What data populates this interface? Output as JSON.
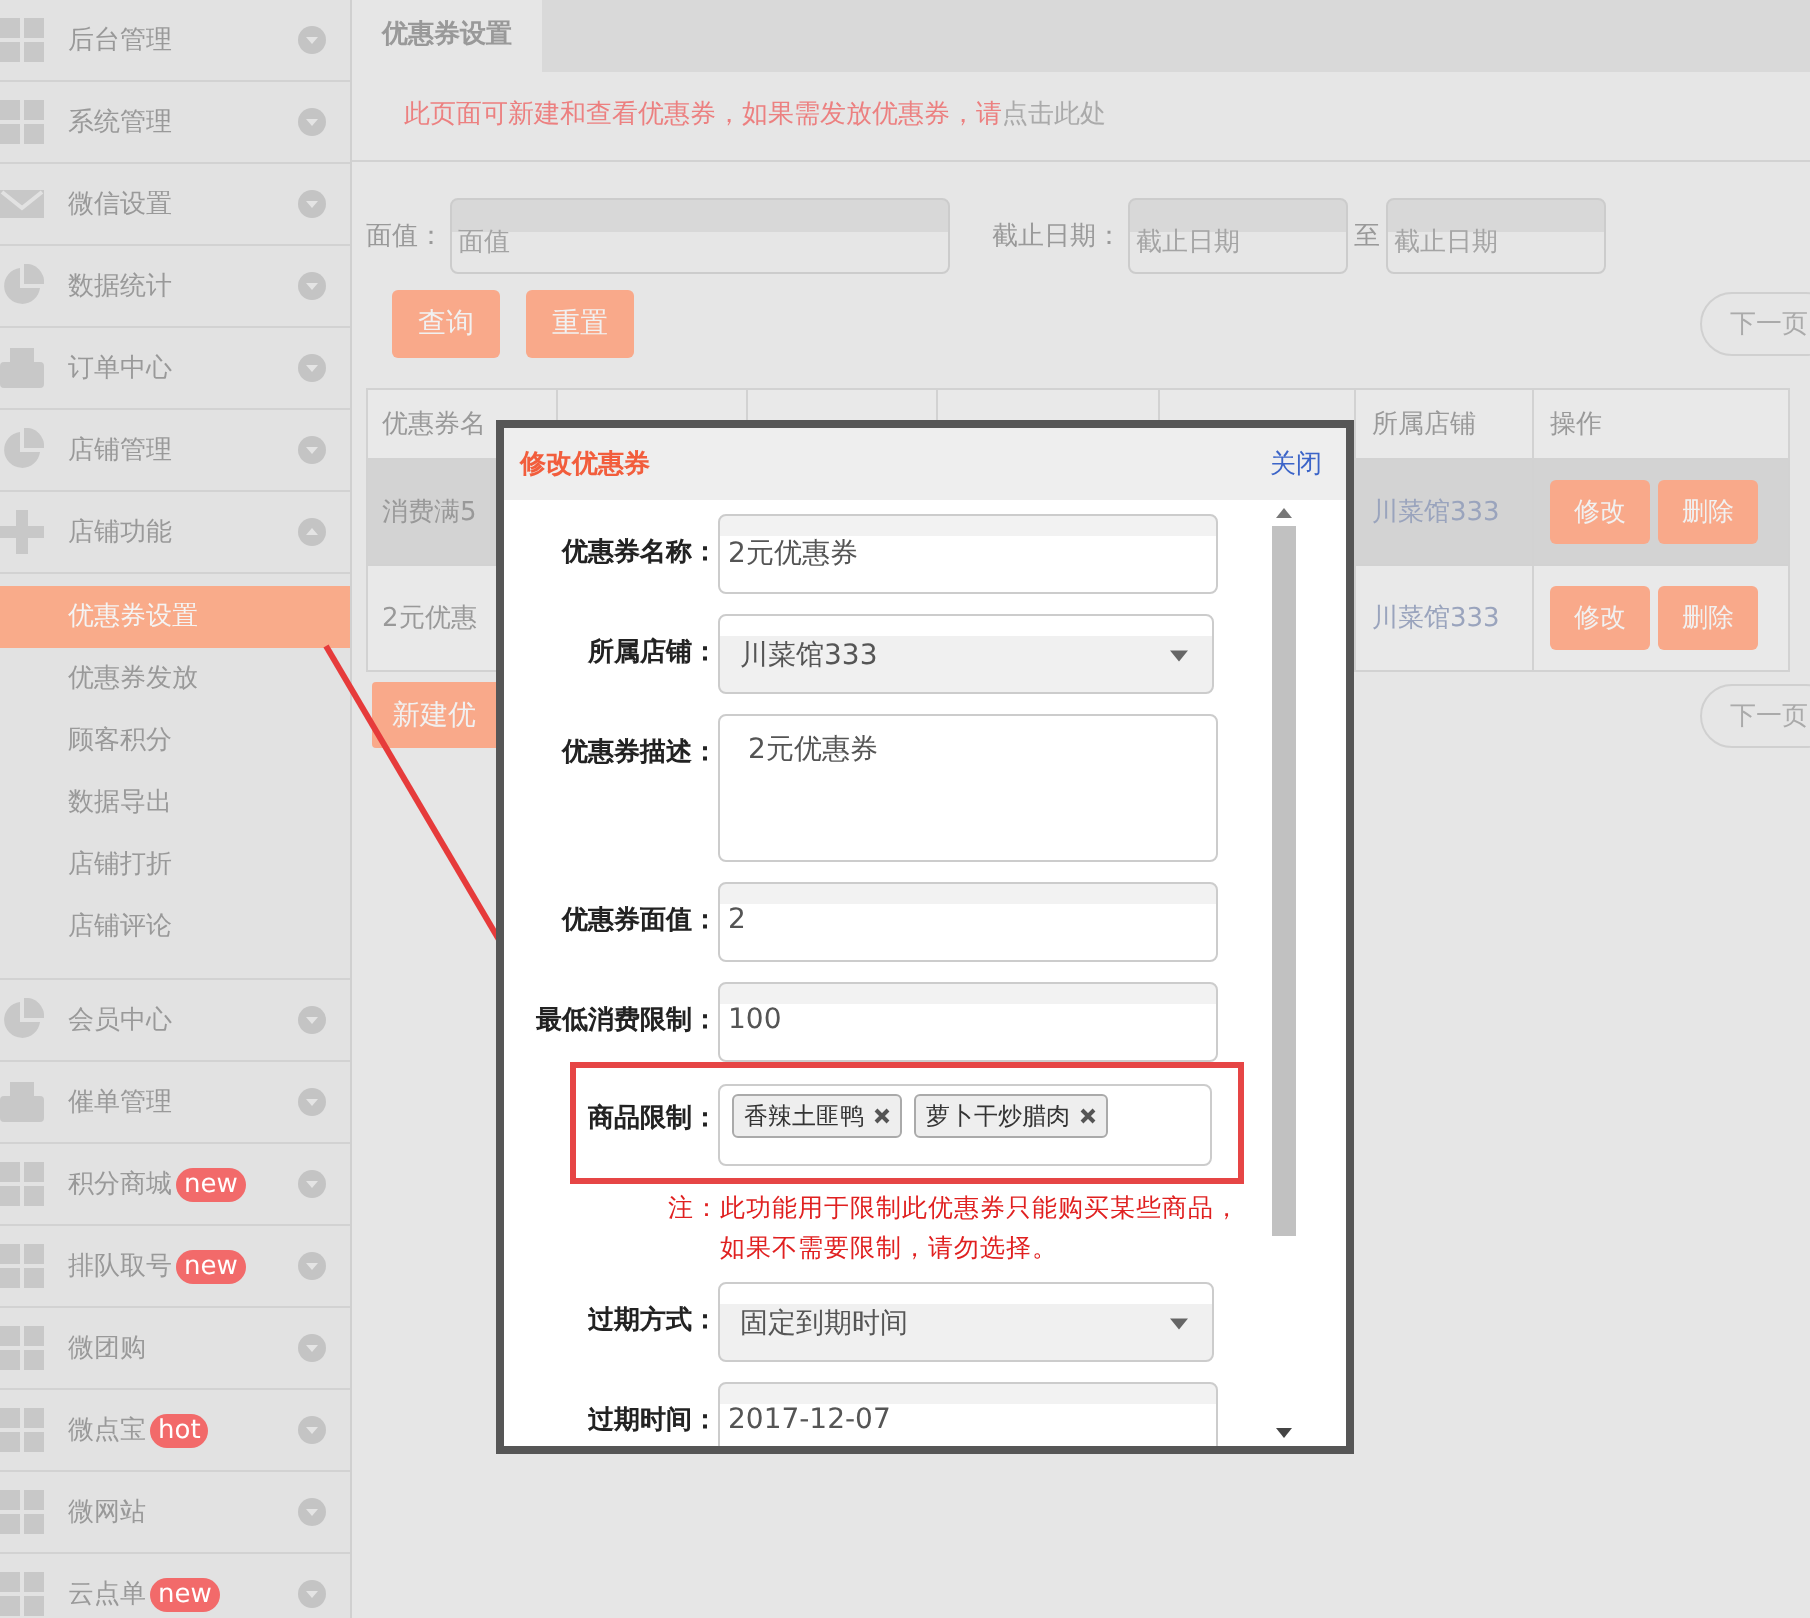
{
  "sidebar": {
    "items": [
      {
        "label": "后台管理",
        "expanded": false
      },
      {
        "label": "系统管理",
        "expanded": false
      },
      {
        "label": "微信设置",
        "expanded": false
      },
      {
        "label": "数据统计",
        "expanded": false
      },
      {
        "label": "订单中心",
        "expanded": false
      },
      {
        "label": "店铺管理",
        "expanded": false
      },
      {
        "label": "店铺功能",
        "expanded": true,
        "children": [
          {
            "label": "优惠券设置",
            "selected": true
          },
          {
            "label": "优惠券发放",
            "selected": false
          },
          {
            "label": "顾客积分",
            "selected": false
          },
          {
            "label": "数据导出",
            "selected": false
          },
          {
            "label": "店铺打折",
            "selected": false
          },
          {
            "label": "店铺评论",
            "selected": false
          }
        ]
      },
      {
        "label": "会员中心",
        "expanded": false
      },
      {
        "label": "催单管理",
        "expanded": false
      },
      {
        "label": "积分商城",
        "expanded": false,
        "badge": "new"
      },
      {
        "label": "排队取号",
        "expanded": false,
        "badge": "new"
      },
      {
        "label": "微团购",
        "expanded": false
      },
      {
        "label": "微点宝",
        "expanded": false,
        "badge": "hot"
      },
      {
        "label": "微网站",
        "expanded": false
      },
      {
        "label": "云点单",
        "expanded": false,
        "badge": "new"
      }
    ]
  },
  "tab": {
    "label": "优惠券设置",
    "selected": true
  },
  "notice": {
    "text": "此页面可新建和查看优惠券，如果需发放优惠券，请",
    "link": "点击此处"
  },
  "filters": {
    "value_label": "面值：",
    "value_placeholder": "面值",
    "date_label": "截止日期：",
    "date_from_placeholder": "截止日期",
    "to_label": "至",
    "date_to_placeholder": "截止日期"
  },
  "buttons": [
    "查询",
    "重置"
  ],
  "next_page": "下一页",
  "table": {
    "columns": [
      "优惠券名",
      "",
      "",
      "",
      "",
      "所属店铺",
      "操作"
    ],
    "rows": [
      {
        "cells": [
          "消费满5",
          "",
          "",
          "",
          "",
          "川菜馆333"
        ],
        "actions": [
          "修改",
          "删除"
        ],
        "highlighted": true
      },
      {
        "cells": [
          "2元优惠",
          "",
          "",
          "",
          "",
          "川菜馆333"
        ],
        "actions": [
          "修改",
          "删除"
        ],
        "highlighted": false
      }
    ]
  },
  "new_button": "新建优",
  "next_page_bottom": "下一页",
  "modal": {
    "title": "修改优惠券",
    "close": "关闭",
    "fields": [
      {
        "kind": "text",
        "label": "优惠券名称：",
        "value": "2元优惠券"
      },
      {
        "kind": "select",
        "label": "所属店铺：",
        "value": "川菜馆333"
      },
      {
        "kind": "textarea",
        "label": "优惠券描述：",
        "value": "2元优惠券"
      },
      {
        "kind": "text",
        "label": "优惠券面值：",
        "value": "2"
      },
      {
        "kind": "text",
        "label": "最低消费限制：",
        "value": "100"
      },
      {
        "kind": "tags",
        "label": "商品限制：",
        "tags": [
          "香辣土匪鸭",
          "萝卜干炒腊肉"
        ],
        "highlighted": true
      },
      {
        "kind": "note",
        "label": "注：",
        "value": "此功能用于限制此优惠券只能购买某些商品，如果不需要限制，请勿选择。"
      },
      {
        "kind": "select",
        "label": "过期方式：",
        "value": "固定到期时间"
      },
      {
        "kind": "text",
        "label": "过期时间：",
        "value": "2017-12-07"
      }
    ]
  }
}
